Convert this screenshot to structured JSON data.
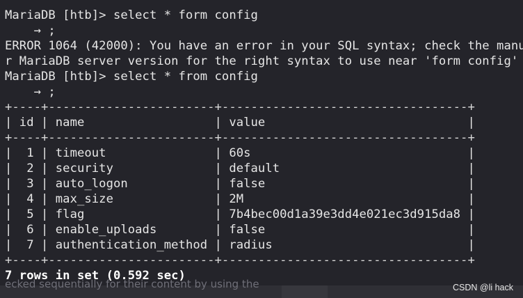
{
  "terminal": {
    "lines": [
      "MariaDB [htb]> select * form config",
      "    → ;",
      "ERROR 1064 (42000): You have an error in your SQL syntax; check the manual",
      "r MariaDB server version for the right syntax to use near 'form config' at",
      "MariaDB [htb]> select * from config",
      "    → ;",
      "+----+-----------------------+----------------------------------+",
      "| id | name                  | value                            |",
      "+----+-----------------------+----------------------------------+",
      "|  1 | timeout               | 60s                              |",
      "|  2 | security              | default                          |",
      "|  3 | auto_logon            | false                            |",
      "|  4 | max_size              | 2M                               |",
      "|  5 | flag                  | 7b4bec00d1a39e3dd4e021ec3d915da8 |",
      "|  6 | enable_uploads        | false                            |",
      "|  7 | authentication_method | radius                           |",
      "+----+-----------------------+----------------------------------+",
      "7 rows in set (0.592 sec)"
    ]
  },
  "background_text": "ecked sequentially for their content by using the",
  "watermark": "CSDN @li hack",
  "colors": {
    "terminal_bg": "#24242a",
    "page_bg": "#2f2f35",
    "text": "#e6e6e6"
  }
}
